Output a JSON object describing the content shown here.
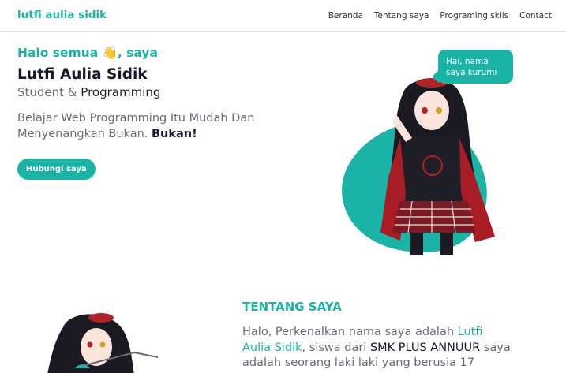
{
  "nav": {
    "logo": "lutfi aulia sidik",
    "items": [
      "Beranda",
      "Tentang saya",
      "Programing skils",
      "Contact"
    ]
  },
  "hero": {
    "greeting": "Halo semua 👋, saya",
    "name": "Lutfi Aulia Sidik",
    "role_prefix": "Student & ",
    "role_strong": "Programming",
    "desc": "Belajar Web Programming Itu Mudah Dan Menyenangkan Bukan.",
    "desc_strong": "Bukan!",
    "cta": "Hubungi saya"
  },
  "bubble": {
    "line1": "Hai, nama",
    "line2": "saya kurumi"
  },
  "about": {
    "title": "TENTANG SAYA",
    "intro": "Halo, Perkenalkan nama saya adalah ",
    "name": "Lutfi Aulia Sidik",
    "school_prefix": ", siswa dari ",
    "school": "SMK PLUS ANNUUR",
    "rest": "saya adalah seorang laki laki yang berusia 17"
  },
  "colors": {
    "accent": "#1bb3a6",
    "text": "#161a2a",
    "muted": "#666c78"
  }
}
